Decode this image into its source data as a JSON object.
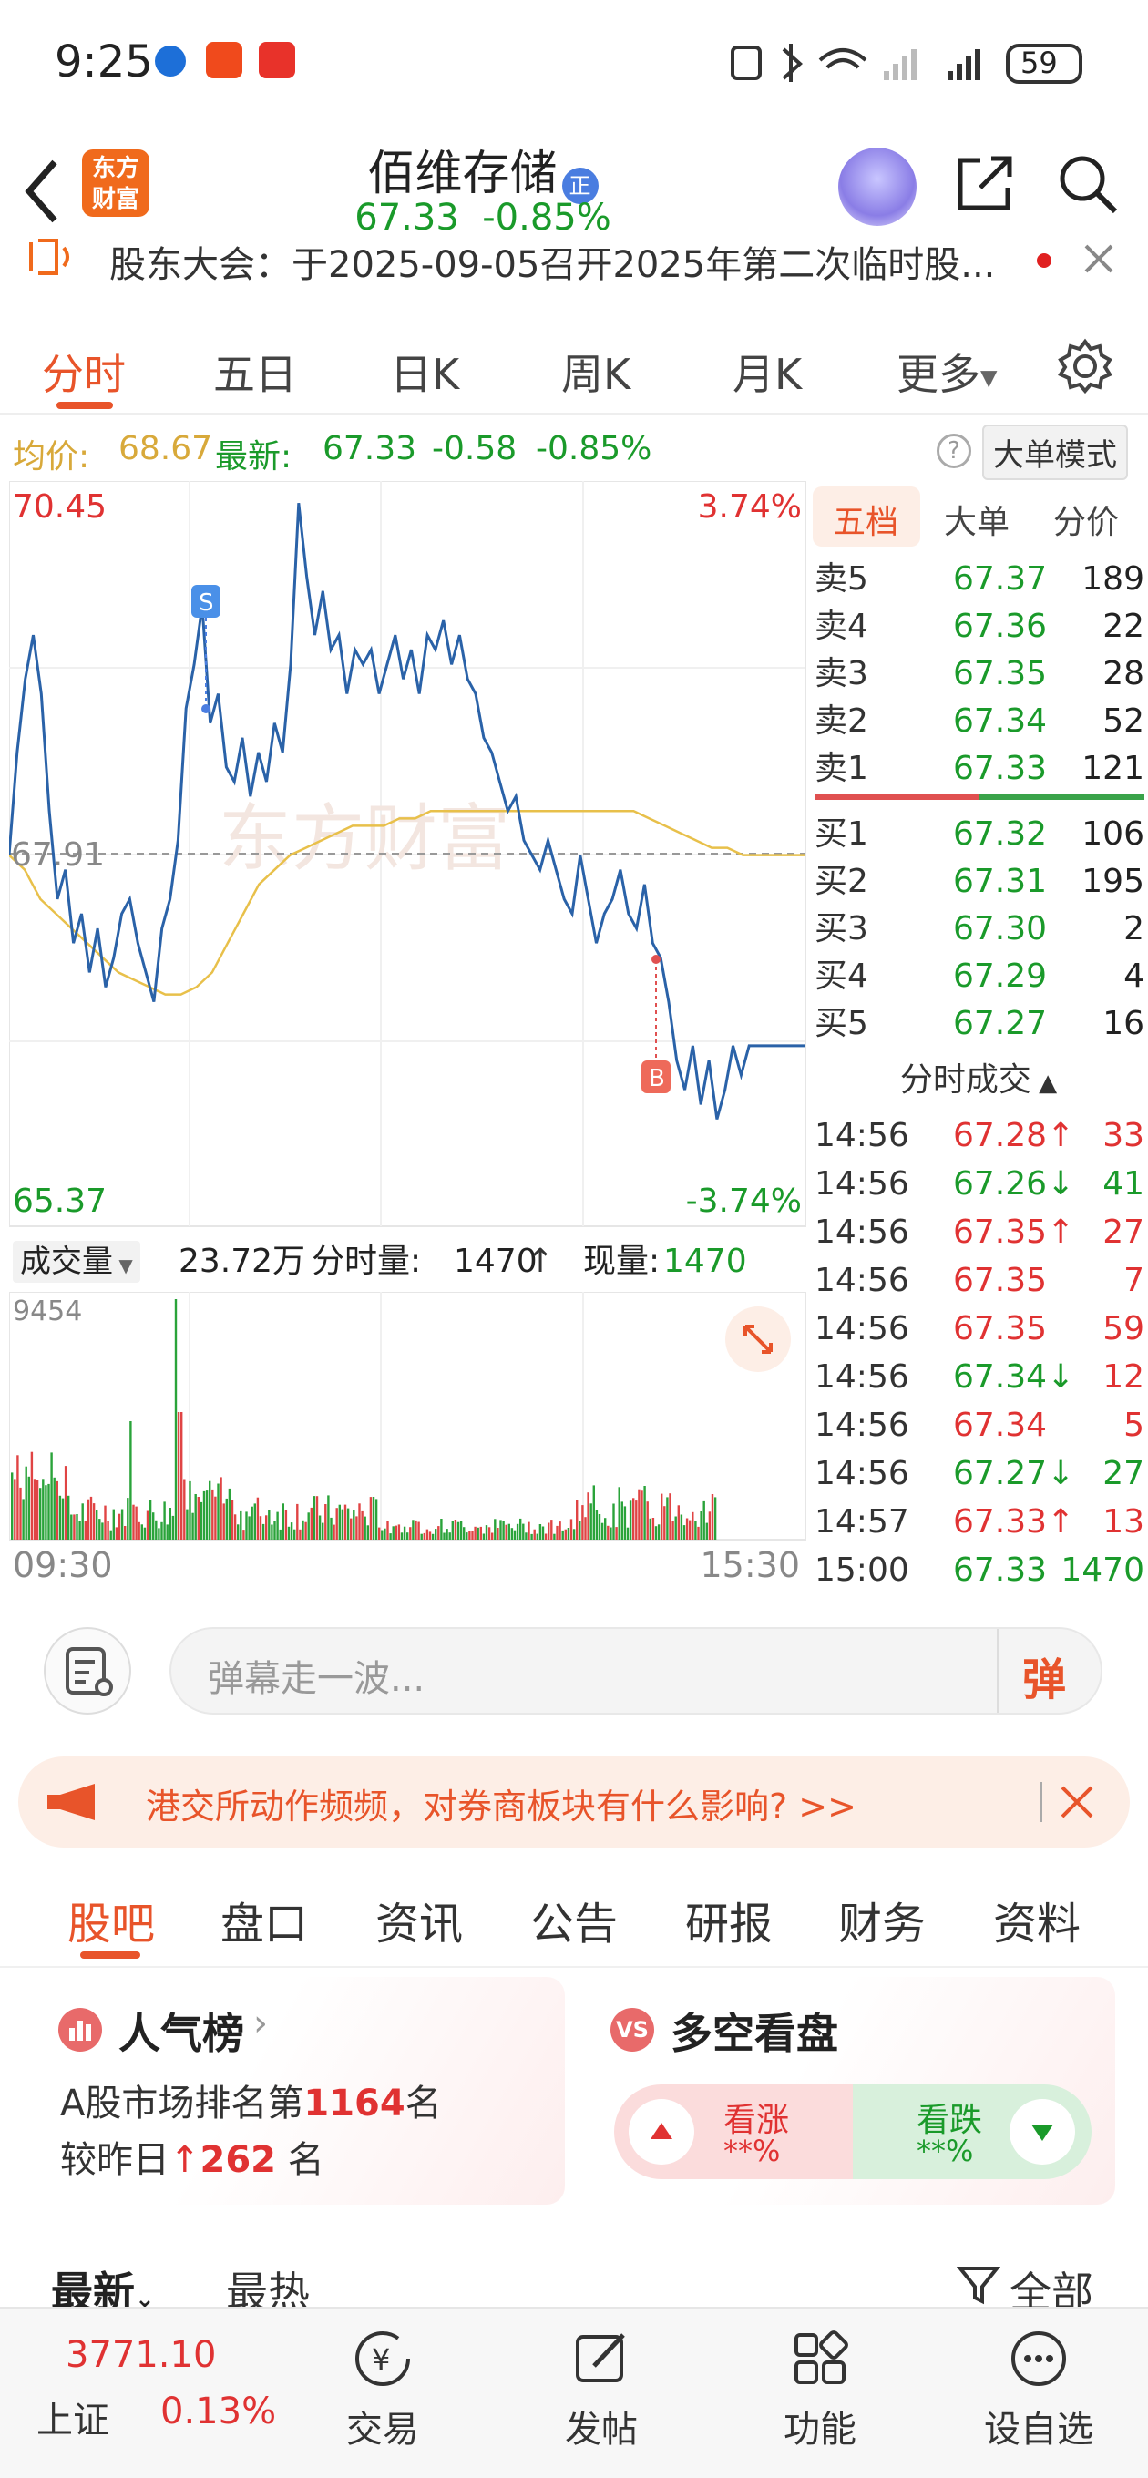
{
  "status": {
    "time": "9:25",
    "battery": "59"
  },
  "header": {
    "brand_logo": "东方财富",
    "stock_name": "佰维存储",
    "badge": "正",
    "price": "67.33",
    "change_pct": "-0.85%"
  },
  "notice": {
    "text": "股东大会：于2025-09-05召开2025年第二次临时股..."
  },
  "tabs": [
    "分时",
    "五日",
    "日K",
    "周K",
    "月K",
    "更多"
  ],
  "info": {
    "avg_label": "均价:",
    "avg_value": "68.67",
    "latest_label": "最新:",
    "latest_value": "67.33",
    "change": "-0.58",
    "change_pct": "-0.85%",
    "mode_button": "大单模式"
  },
  "chart": {
    "y_high": "70.45",
    "y_low": "65.37",
    "pct_high": "3.74%",
    "pct_low": "-3.74%",
    "prev_close": "67.91",
    "watermark": "东方财富",
    "sell_marker": "S",
    "buy_marker": "B",
    "volume_label": "成交量",
    "volume_total": "23.72万",
    "tick_volume_label": "分时量:",
    "tick_volume_value": "1470",
    "current_volume_label": "现量:",
    "current_volume_value": "1470",
    "vol_max": "9454",
    "time_start": "09:30",
    "time_end": "15:30"
  },
  "chart_data": {
    "type": "line",
    "ylim": [
      65.37,
      70.45
    ],
    "prev_close": 67.91,
    "price_series": [
      67.9,
      68.6,
      69.1,
      69.4,
      69.0,
      68.2,
      67.6,
      67.8,
      67.3,
      67.5,
      67.1,
      67.4,
      67.0,
      67.2,
      67.5,
      67.6,
      67.3,
      67.1,
      66.9,
      67.4,
      67.6,
      68.0,
      68.9,
      69.2,
      69.6,
      68.8,
      69.0,
      68.5,
      68.4,
      68.7,
      68.3,
      68.6,
      68.4,
      68.8,
      68.6,
      69.2,
      70.3,
      69.8,
      69.4,
      69.7,
      69.3,
      69.4,
      69.0,
      69.3,
      69.2,
      69.3,
      69.0,
      69.2,
      69.4,
      69.1,
      69.3,
      69.0,
      69.4,
      69.3,
      69.5,
      69.2,
      69.4,
      69.1,
      69.0,
      68.7,
      68.6,
      68.4,
      68.2,
      68.3,
      68.0,
      67.9,
      67.8,
      68.0,
      67.8,
      67.6,
      67.5,
      67.9,
      67.6,
      67.3,
      67.5,
      67.6,
      67.8,
      67.5,
      67.4,
      67.7,
      67.3,
      67.2,
      66.9,
      66.5,
      66.3,
      66.6,
      66.2,
      66.5,
      66.1,
      66.3,
      66.6,
      66.4,
      66.6,
      66.6,
      66.6,
      66.6,
      66.6,
      66.6,
      66.6,
      66.6
    ],
    "avg_series": [
      67.9,
      67.8,
      67.6,
      67.5,
      67.4,
      67.3,
      67.2,
      67.1,
      67.05,
      67.0,
      66.95,
      66.95,
      67.0,
      67.1,
      67.3,
      67.5,
      67.7,
      67.8,
      67.9,
      67.95,
      68.0,
      68.05,
      68.1,
      68.1,
      68.1,
      68.15,
      68.15,
      68.2,
      68.2,
      68.2,
      68.2,
      68.2,
      68.2,
      68.2,
      68.2,
      68.2,
      68.2,
      68.2,
      68.2,
      68.2,
      68.2,
      68.15,
      68.1,
      68.05,
      68.0,
      67.95,
      67.95,
      67.9,
      67.9,
      67.9,
      67.9,
      67.9
    ]
  },
  "orderbook": {
    "tabs": [
      "五档",
      "大单",
      "分价"
    ],
    "asks": [
      {
        "label": "卖5",
        "price": "67.37",
        "vol": "189"
      },
      {
        "label": "卖4",
        "price": "67.36",
        "vol": "22"
      },
      {
        "label": "卖3",
        "price": "67.35",
        "vol": "28"
      },
      {
        "label": "卖2",
        "price": "67.34",
        "vol": "52"
      },
      {
        "label": "卖1",
        "price": "67.33",
        "vol": "121"
      }
    ],
    "bids": [
      {
        "label": "买1",
        "price": "67.32",
        "vol": "106"
      },
      {
        "label": "买2",
        "price": "67.31",
        "vol": "195"
      },
      {
        "label": "买3",
        "price": "67.30",
        "vol": "2"
      },
      {
        "label": "买4",
        "price": "67.29",
        "vol": "4"
      },
      {
        "label": "买5",
        "price": "67.27",
        "vol": "16"
      }
    ],
    "trades_title": "分时成交",
    "trades": [
      {
        "time": "14:56",
        "price": "67.28",
        "arrow": "↑",
        "vol": "33",
        "color": "#e03232"
      },
      {
        "time": "14:56",
        "price": "67.26",
        "arrow": "↓",
        "vol": "41",
        "color": "#1a9a2a"
      },
      {
        "time": "14:56",
        "price": "67.35",
        "arrow": "↑",
        "vol": "27",
        "color": "#e03232"
      },
      {
        "time": "14:56",
        "price": "67.35",
        "arrow": "",
        "vol": "7",
        "color": "#e03232"
      },
      {
        "time": "14:56",
        "price": "67.35",
        "arrow": "",
        "vol": "59",
        "color": "#e03232"
      },
      {
        "time": "14:56",
        "price": "67.34",
        "arrow": "↓",
        "vol": "12",
        "color": "#e03232"
      },
      {
        "time": "14:56",
        "price": "67.34",
        "arrow": "",
        "vol": "5",
        "color": "#e03232"
      },
      {
        "time": "14:56",
        "price": "67.27",
        "arrow": "↓",
        "vol": "27",
        "color": "#1a9a2a"
      },
      {
        "time": "14:57",
        "price": "67.33",
        "arrow": "↑",
        "vol": "13",
        "color": "#e03232"
      },
      {
        "time": "15:00",
        "price": "67.33",
        "arrow": "",
        "vol": "1470",
        "color": "#1a9a2a"
      }
    ]
  },
  "danmu": {
    "placeholder": "弹幕走一波...",
    "button": "弹"
  },
  "promo": {
    "text": "港交所动作频频，对券商板块有什么影响? >>"
  },
  "subtabs": [
    "股吧",
    "盘口",
    "资讯",
    "公告",
    "研报",
    "财务",
    "资料"
  ],
  "cards": {
    "popularity": {
      "title": "人气榜",
      "line1_prefix": "A股市场排名第",
      "line1_value": "1164",
      "line1_suffix": "名",
      "line2_prefix": "较昨日",
      "line2_value": "262",
      "line2_suffix": "名"
    },
    "sentiment": {
      "title": "多空看盘",
      "bull_label": "看涨",
      "bull_value": "**%",
      "bear_label": "看跌",
      "bear_value": "**%"
    }
  },
  "feed": {
    "sort_latest": "最新",
    "sort_hot": "最热",
    "filter": "全部"
  },
  "bottomnav": {
    "index_value": "3771.10",
    "index_name": "上证",
    "index_change": "0.13%",
    "items": [
      "交易",
      "发帖",
      "功能",
      "设自选"
    ]
  }
}
